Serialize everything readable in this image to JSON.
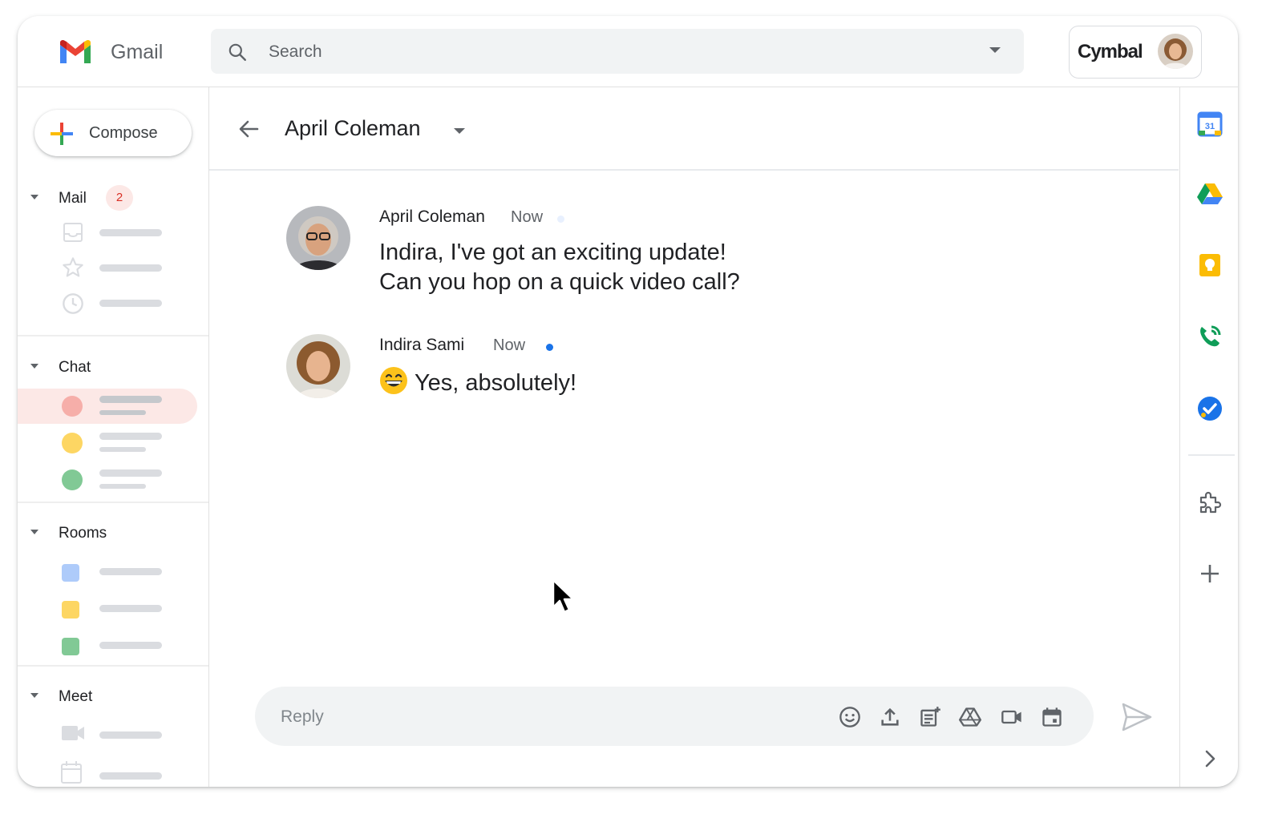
{
  "header": {
    "app_name": "Gmail",
    "search_placeholder": "Search",
    "account_brand": "Cymbal"
  },
  "sidebar": {
    "compose_label": "Compose",
    "sections": {
      "mail": {
        "label": "Mail",
        "badge": "2"
      },
      "chat": {
        "label": "Chat"
      },
      "rooms": {
        "label": "Rooms"
      },
      "meet": {
        "label": "Meet"
      }
    },
    "colors": {
      "chat_dots": [
        "#f6aea9",
        "#fdd663",
        "#81c995"
      ],
      "room_squares": [
        "#aecbfa",
        "#fdd663",
        "#81c995"
      ]
    }
  },
  "thread": {
    "title": "April Coleman",
    "messages": [
      {
        "sender": "April Coleman",
        "time": "Now",
        "lines": [
          "Indira, I've got an exciting update!",
          "Can you hop on a quick video call?"
        ],
        "status_color": "#e8f0fe"
      },
      {
        "sender": "Indira Sami",
        "time": "Now",
        "lines": [
          "Yes, absolutely!"
        ],
        "emoji": "grinning-face",
        "status_color": "#1a73e8"
      }
    ]
  },
  "reply": {
    "placeholder": "Reply",
    "tools": [
      "emoji-icon",
      "upload-icon",
      "add-doc-icon",
      "drive-icon",
      "video-icon",
      "calendar-icon"
    ]
  },
  "right_rail": {
    "icons": [
      "calendar-icon",
      "drive-icon",
      "keep-icon",
      "voice-icon",
      "tasks-icon",
      "addons-icon",
      "add-icon",
      "expand-icon"
    ]
  }
}
